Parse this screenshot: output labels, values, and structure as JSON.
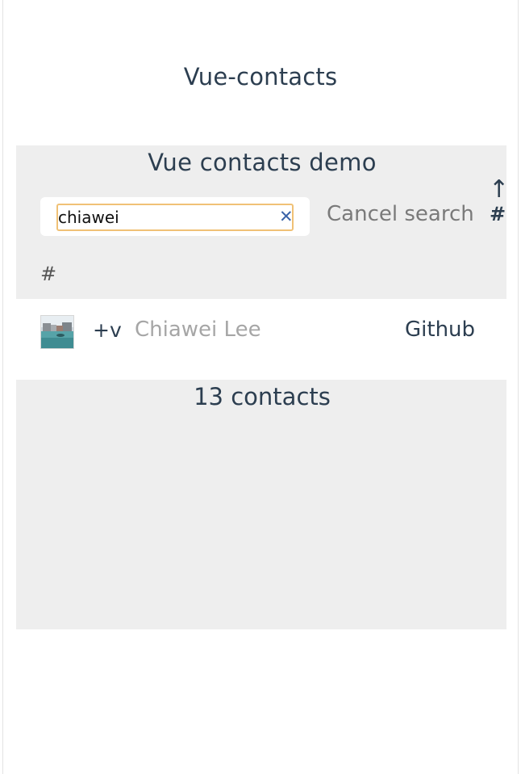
{
  "app": {
    "title": "Vue-contacts"
  },
  "header": {
    "demo_title": "Vue contacts demo",
    "search": {
      "value": "chiawei",
      "clear_icon": "close-icon",
      "clear_symbol": "✕"
    },
    "cancel_search_label": "Cancel search",
    "sort": {
      "arrow": "↑",
      "label": "#"
    },
    "section_letter": "#"
  },
  "contacts": [
    {
      "prefix": "+v",
      "name": "Chiawei Lee",
      "link_label": "Github",
      "avatar_icon": "avatar"
    }
  ],
  "footer": {
    "count_label": "13 contacts"
  },
  "colors": {
    "text": "#2c3e50",
    "panel_bg": "#eeeeee",
    "input_focus_border": "#f0c176",
    "clear_icon": "#3a63a8",
    "muted_text": "#a6a6a6"
  }
}
